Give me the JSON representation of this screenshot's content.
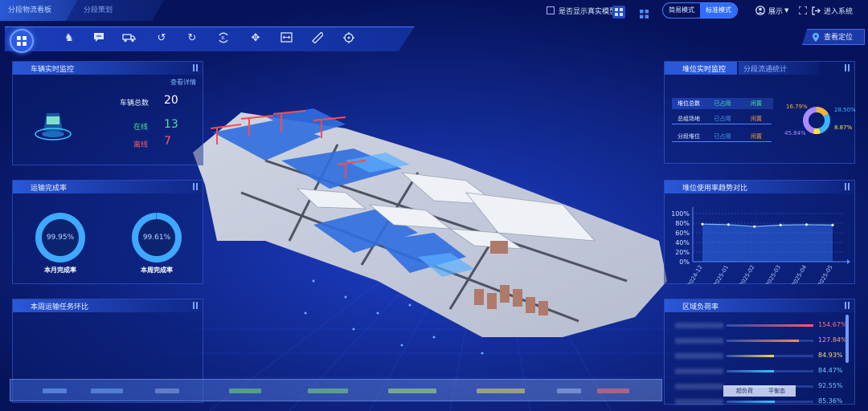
{
  "tabs": [
    {
      "label": "分段物流看板",
      "active": true
    },
    {
      "label": "分段策划",
      "active": false
    }
  ],
  "header": {
    "show_real_model_label": "是否显示真实模型",
    "mode_simple": "简易模式",
    "mode_standard": "标准模式",
    "user_label": "展示",
    "enter_system_label": "进入系统"
  },
  "toolbar": {
    "tools": [
      "home-grid-icon",
      "crane-icon",
      "comment-icon",
      "truck-icon",
      "undo-icon",
      "redo-icon",
      "reset-view-icon",
      "move-icon",
      "fit-width-icon",
      "ruler-icon",
      "crosshair-icon"
    ],
    "locate_label": "查看定位"
  },
  "vehicle_panel": {
    "title": "车辆实时监控",
    "detail_link": "查看详情",
    "total_label": "车辆总数",
    "total_value": "20",
    "online_label": "在线",
    "online_value": "13",
    "offline_label": "离线",
    "offline_value": "7"
  },
  "transport_panel": {
    "title": "运输完成率",
    "month_value": "99.95%",
    "month_label": "本月完成率",
    "week_value": "99.61%",
    "week_label": "本周完成率",
    "month_fraction": 0.9995,
    "week_fraction": 0.9961
  },
  "weekly_panel": {
    "title": "本周运输任务环比"
  },
  "stack_panel": {
    "tab_active": "堆位实时监控",
    "tab_other": "分段流通统计",
    "table_headers": [
      "堆位总数",
      "已占用",
      "闲置"
    ],
    "rows": [
      [
        "总组场地",
        "已占用",
        "闲置"
      ],
      [
        "分段堆位",
        "已占用",
        "闲置"
      ]
    ],
    "donut": {
      "labels": [
        "16.79%",
        "28.50%",
        "8.87%",
        "45.84%"
      ],
      "values": [
        16.79,
        28.5,
        8.87,
        45.84
      ],
      "colors": [
        "#f0b43a",
        "#38b6ff",
        "#ffe04a",
        "#a98aff"
      ]
    }
  },
  "trend_panel": {
    "title": "堆位使用率趋势对比"
  },
  "load_panel": {
    "title": "区域负荷率",
    "values": [
      "154.67%",
      "127.84%",
      "84.93%",
      "84.47%",
      "92.55%",
      "85.36%"
    ],
    "fractions": [
      1.0,
      0.83,
      0.55,
      0.55,
      0.6,
      0.56
    ],
    "colors": [
      "#ff5b6b",
      "#f08a5a",
      "#f5d54a",
      "#34c6ff",
      "#34c6ff",
      "#34c6ff"
    ],
    "value_colors": [
      "#ff6b7a",
      "#f0a27a",
      "#f5d87a",
      "#6fcaff",
      "#6fcaff",
      "#6fcaff"
    ],
    "legend_a": "超负荷",
    "legend_b": "平衡态"
  },
  "chart_data": {
    "type": "area",
    "title": "堆位使用率趋势对比",
    "x": [
      "2024-12",
      "2025-01",
      "2025-02",
      "2025-03",
      "2025-04",
      "2025-05"
    ],
    "series": [
      {
        "values": [
          78,
          77,
          73,
          76,
          77,
          76
        ]
      }
    ],
    "y_ticks": [
      "0%",
      "20%",
      "40%",
      "60%",
      "80%",
      "100%"
    ],
    "ylim": [
      0,
      100
    ],
    "grid": true
  }
}
